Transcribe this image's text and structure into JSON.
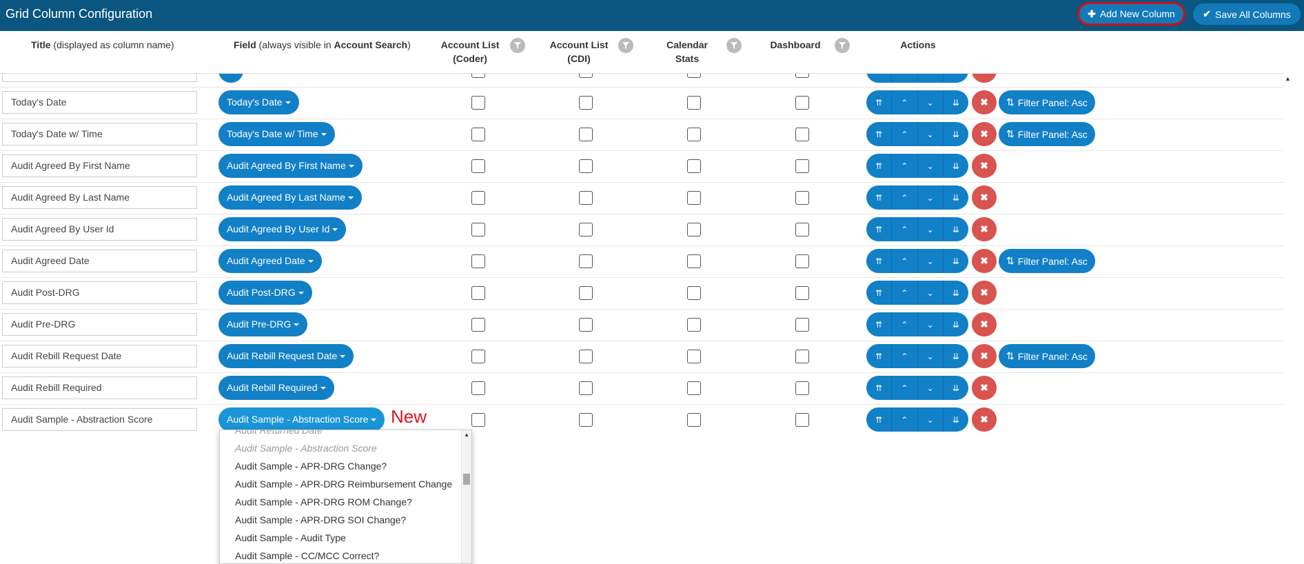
{
  "app": {
    "title": "Grid Column Configuration"
  },
  "toolbar": {
    "add_label": "Add New Column",
    "save_label": "Save All Columns",
    "add_icon": "plus-icon",
    "save_icon": "check-icon"
  },
  "headers": {
    "title_bold": "Title",
    "title_rest": " (displayed as column name)",
    "field_bold": "Field",
    "field_mid": " (always visible in ",
    "field_bold2": "Account Search",
    "field_end": ")",
    "coder_1": "Account List",
    "coder_2": "(Coder)",
    "cdi_1": "Account List",
    "cdi_2": "(CDI)",
    "cal_1": "Calendar",
    "cal_2": "Stats",
    "dashboard": "Dashboard",
    "actions": "Actions"
  },
  "rows": [
    {
      "title": "",
      "field": "",
      "sort": ""
    },
    {
      "title": "Today's Date",
      "field": "Today's Date",
      "sort": "Filter Panel: Asc"
    },
    {
      "title": "Today's Date w/ Time",
      "field": "Today's Date w/ Time",
      "sort": "Filter Panel: Asc"
    },
    {
      "title": "Audit Agreed By First Name",
      "field": "Audit Agreed By First Name",
      "sort": ""
    },
    {
      "title": "Audit Agreed By Last Name",
      "field": "Audit Agreed By Last Name",
      "sort": ""
    },
    {
      "title": "Audit Agreed By User Id",
      "field": "Audit Agreed By User Id",
      "sort": ""
    },
    {
      "title": "Audit Agreed Date",
      "field": "Audit Agreed Date",
      "sort": "Filter Panel: Asc"
    },
    {
      "title": "Audit Post-DRG",
      "field": "Audit Post-DRG",
      "sort": ""
    },
    {
      "title": "Audit Pre-DRG",
      "field": "Audit Pre-DRG",
      "sort": ""
    },
    {
      "title": "Audit Rebill Request Date",
      "field": "Audit Rebill Request Date",
      "sort": "Filter Panel: Asc"
    },
    {
      "title": "Audit Rebill Required",
      "field": "Audit Rebill Required",
      "sort": ""
    },
    {
      "title": "Audit Sample - Abstraction Score",
      "field": "Audit Sample - Abstraction Score",
      "sort": ""
    }
  ],
  "new_label": "New",
  "dropdown": {
    "items": [
      {
        "label": "Audit Returned Date",
        "disabled": true
      },
      {
        "label": "Audit Sample - Abstraction Score",
        "disabled": true
      },
      {
        "label": "Audit Sample - APR-DRG Change?",
        "disabled": false
      },
      {
        "label": "Audit Sample - APR-DRG Reimbursement Change",
        "disabled": false
      },
      {
        "label": "Audit Sample - APR-DRG ROM Change?",
        "disabled": false
      },
      {
        "label": "Audit Sample - APR-DRG SOI Change?",
        "disabled": false
      },
      {
        "label": "Audit Sample - Audit Type",
        "disabled": false
      },
      {
        "label": "Audit Sample - CC/MCC Correct?",
        "disabled": false
      }
    ]
  },
  "colors": {
    "topbar": "#0a5680",
    "pill": "#1280c6",
    "danger": "#d9534f",
    "highlight": "#d0101a"
  }
}
